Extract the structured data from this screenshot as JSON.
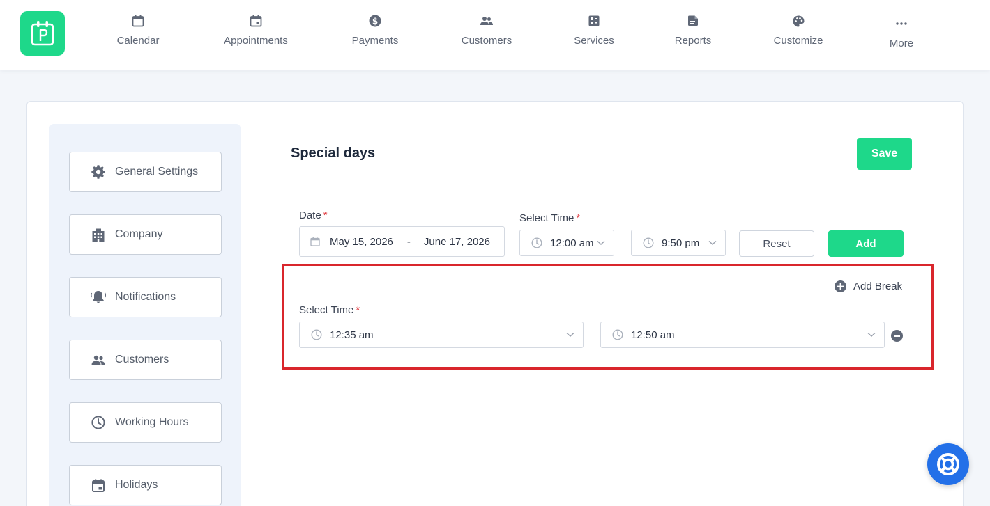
{
  "nav": {
    "items": [
      {
        "label": "Calendar",
        "icon": "calendar-icon"
      },
      {
        "label": "Appointments",
        "icon": "calendar-event-icon"
      },
      {
        "label": "Payments",
        "icon": "dollar-circle-icon"
      },
      {
        "label": "Customers",
        "icon": "users-icon"
      },
      {
        "label": "Services",
        "icon": "services-grid-icon"
      },
      {
        "label": "Reports",
        "icon": "report-icon"
      },
      {
        "label": "Customize",
        "icon": "palette-icon"
      },
      {
        "label": "More",
        "icon": "more-dots-icon"
      }
    ]
  },
  "sidebar": {
    "items": [
      {
        "label": "General Settings",
        "icon": "gear-icon"
      },
      {
        "label": "Company",
        "icon": "building-icon"
      },
      {
        "label": "Notifications",
        "icon": "bell-icon"
      },
      {
        "label": "Customers",
        "icon": "users-icon"
      },
      {
        "label": "Working Hours",
        "icon": "clock-icon"
      },
      {
        "label": "Holidays",
        "icon": "calendar-icon"
      }
    ]
  },
  "main": {
    "title": "Special days",
    "save_label": "Save",
    "date_label": "Date",
    "date_start": "May 15, 2026",
    "date_separator": "-",
    "date_end": "June 17, 2026",
    "select_time_label": "Select Time",
    "time_start": "12:00 am",
    "time_end": "9:50 pm",
    "reset_label": "Reset",
    "add_label": "Add",
    "required_mark": "*"
  },
  "break": {
    "add_break_label": "Add Break",
    "select_time_label": "Select Time",
    "time_start": "12:35 am",
    "time_end": "12:50 am"
  },
  "colors": {
    "brand_green": "#1ed88a",
    "help_blue": "#2370e8",
    "highlight_red": "#d9262c"
  }
}
